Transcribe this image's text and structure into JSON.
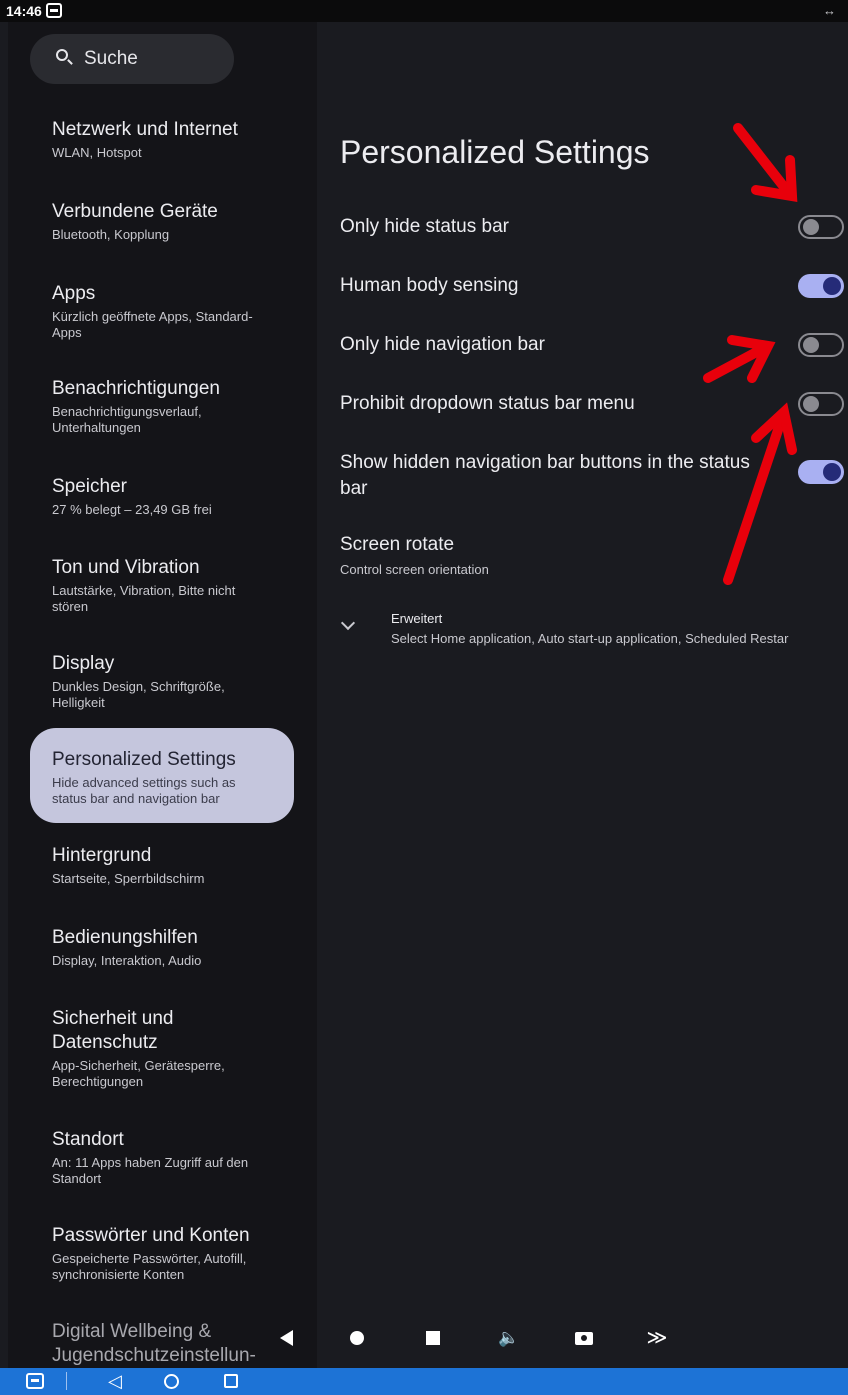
{
  "status_bar": {
    "time": "14:46",
    "right_icon": "↔",
    "remote_badge_icon": "teamviewer-icon"
  },
  "search": {
    "label": "Suche",
    "icon": "search-icon"
  },
  "nav_items": [
    {
      "title": "Netzwerk und Internet",
      "subtitle": "WLAN, Hotspot"
    },
    {
      "title": "Verbundene Geräte",
      "subtitle": "Bluetooth, Kopplung"
    },
    {
      "title": "Apps",
      "subtitle": "Kürzlich geöffnete Apps, Standard-Apps"
    },
    {
      "title": "Benachrichtigungen",
      "subtitle": "Benachrichtigungsverlauf, Unterhaltungen"
    },
    {
      "title": "Speicher",
      "subtitle": "27 % belegt – 23,49 GB frei"
    },
    {
      "title": "Ton und Vibration",
      "subtitle": "Lautstärke, Vibration, Bitte nicht stören"
    },
    {
      "title": "Display",
      "subtitle": "Dunkles Design, Schriftgröße, Helligkeit"
    },
    {
      "title": "Personalized Settings",
      "subtitle": "Hide advanced settings such as status bar and navigation bar",
      "active": true
    },
    {
      "title": "Hintergrund",
      "subtitle": "Startseite, Sperrbildschirm"
    },
    {
      "title": "Bedienungshilfen",
      "subtitle": "Display, Interaktion, Audio"
    },
    {
      "title": "Sicherheit und Datenschutz",
      "subtitle": "App-Sicherheit, Gerätesperre, Berechtigungen"
    },
    {
      "title": "Standort",
      "subtitle": "An: 11 Apps haben Zugriff auf den Standort"
    },
    {
      "title": "Passwörter und Konten",
      "subtitle": "Gespeicherte Passwörter, Autofill, synchronisierte Konten"
    },
    {
      "title": "Digital Wellbeing & Jugendschutzeinstellun-",
      "subtitle": ""
    }
  ],
  "page": {
    "title": "Personalized Settings",
    "switches": [
      {
        "label": "Only hide status bar",
        "checked": false
      },
      {
        "label": "Human body sensing",
        "checked": true
      },
      {
        "label": "Only hide navigation bar",
        "checked": false
      },
      {
        "label": "Prohibit dropdown status bar menu",
        "checked": false
      },
      {
        "label": "Show hidden navigation bar buttons in the status bar",
        "checked": true
      }
    ],
    "screen_rotate": {
      "title": "Screen rotate",
      "subtitle": "Control screen orientation"
    },
    "advanced": {
      "title": "Erweitert",
      "subtitle": "Select Home application, Auto start-up application, Scheduled Restar"
    }
  },
  "floating_toolbar": {
    "buttons": [
      "back-icon",
      "home-icon",
      "recents-icon",
      "volume-icon",
      "camera-icon",
      "collapse-icon"
    ],
    "volume_glyph": "🔈",
    "collapse_glyph": "≫"
  },
  "system_bar": {
    "back_glyph": "◁",
    "color": "#1d73d6"
  },
  "colors": {
    "toggle_on_track": "#a9b0f2",
    "toggle_on_knob": "#252b78",
    "active_nav_bg": "#c5c6dd",
    "annotation_arrow": "#e8000b"
  }
}
